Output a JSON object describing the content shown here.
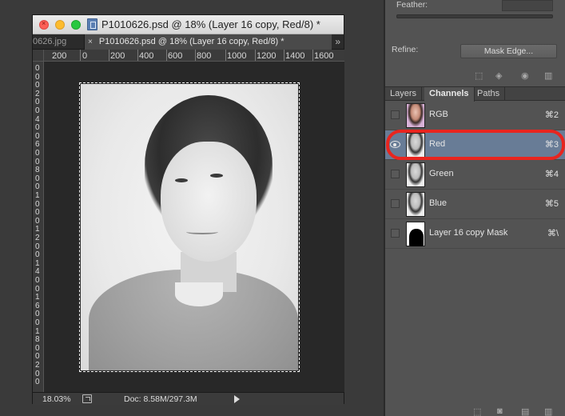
{
  "document": {
    "window_title": "P1010626.psd @ 18% (Layer 16 copy, Red/8) *",
    "tabs": {
      "inactive": "0626.jpg",
      "active_close": "×",
      "active": "P1010626.psd @ 18% (Layer 16 copy, Red/8) *",
      "overflow": "»"
    },
    "ruler_top_labels": [
      "200",
      "0",
      "200",
      "400",
      "600",
      "800",
      "1000",
      "1200",
      "1400",
      "1600"
    ],
    "ruler_left_chars": [
      "0",
      "0",
      "0",
      "2",
      "0",
      "0",
      "4",
      "0",
      "0",
      "6",
      "0",
      "0",
      "8",
      "0",
      "0",
      "1",
      "0",
      "0",
      "0",
      "1",
      "2",
      "0",
      "0",
      "1",
      "4",
      "0",
      "0",
      "1",
      "6",
      "0",
      "0",
      "1",
      "8",
      "0",
      "0",
      "2",
      "0",
      "0"
    ],
    "status": {
      "zoom": "18.03%",
      "doc_size": "Doc: 8.58M/297.3M"
    }
  },
  "properties": {
    "feather_label": "Feather:",
    "refine_label": "Refine:",
    "mask_edge_button": "Mask Edge..."
  },
  "panel_tabs": [
    "Layers",
    "Channels",
    "Paths"
  ],
  "channels": [
    {
      "name": "RGB",
      "shortcut": "⌘2",
      "visible": false,
      "selected": false
    },
    {
      "name": "Red",
      "shortcut": "⌘3",
      "visible": true,
      "selected": true
    },
    {
      "name": "Green",
      "shortcut": "⌘4",
      "visible": false,
      "selected": false
    },
    {
      "name": "Blue",
      "shortcut": "⌘5",
      "visible": false,
      "selected": false
    },
    {
      "name": "Layer 16 copy Mask",
      "shortcut": "⌘\\",
      "visible": false,
      "selected": false
    }
  ],
  "colors": {
    "selected_row": "#687c96",
    "highlight_ring": "#e8251f",
    "panel_bg": "#535353"
  }
}
